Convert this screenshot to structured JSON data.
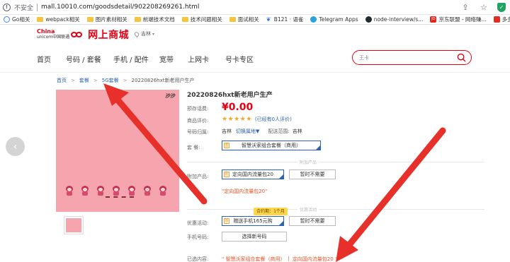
{
  "browser": {
    "insecure_label": "不安全",
    "url": "mall.10010.com/goodsdetail/902208269261.html",
    "bookmarks": [
      {
        "label": "Go相关",
        "icon": "google-icon"
      },
      {
        "label": "webpack相关",
        "icon": "folder-icon"
      },
      {
        "label": "图片素材相关",
        "icon": "folder-icon"
      },
      {
        "label": "前端技术文档",
        "icon": "folder-icon"
      },
      {
        "label": "技术问题相关",
        "icon": "folder-icon"
      },
      {
        "label": "面试相关",
        "icon": "folder-icon"
      },
      {
        "label": "B121 · 语雀",
        "icon": "yuque-icon"
      },
      {
        "label": "Telegram Apps",
        "icon": "telegram-icon"
      },
      {
        "label": "node-interview/s...",
        "icon": "github-icon"
      },
      {
        "label": "京东联盟 - 网络赚...",
        "icon": "jd-icon"
      },
      {
        "label": "多多进宝",
        "icon": "pdd-icon"
      }
    ]
  },
  "site": {
    "brand_en": "China",
    "brand_en2": "unicom",
    "brand_cn": "中国联通",
    "shop_name": "网上商城",
    "location": "吉林"
  },
  "nav": {
    "items": [
      "首页",
      "号码 / 套餐",
      "手机 / 配件",
      "宽带",
      "上网卡",
      "号卡专区"
    ],
    "search_placeholder": "王卡"
  },
  "breadcrumb": {
    "items": [
      "首页",
      "套餐",
      "5G套餐"
    ],
    "current": "20220826hxt新老用户生产"
  },
  "product": {
    "image_badge": "沙沙",
    "title": "20220826hxt新老用户生产",
    "price_label": "预存话费:",
    "price": "¥0.00",
    "rating_label": "商品评价:",
    "stars": 5,
    "rating_count": "(已经有0人评价)",
    "number_label": "号码归属:",
    "number_location": "吉林",
    "switch_link": "切换属地▼",
    "delivery_label": "配送范围:",
    "delivery_area": "吉林",
    "package_label": "套    餐:",
    "package_option": "智慧沃家组合套餐（商用）",
    "addon_section": "附加产品",
    "addon_label": "附加产品:",
    "addon_options": [
      "定向国内流量包20",
      "暂时不需要"
    ],
    "addon_note": "\"定向国内流量包20\"",
    "promo_section": "优惠活动",
    "promo_ribbon": "合约期：1个月",
    "promo_label": "优惠活动:",
    "promo_options": [
      "赠送手机165元购",
      "暂时不需要"
    ],
    "phone_label": "手机号码:",
    "phone_button": "选择新号码",
    "selected_label": "已选内容:",
    "selected_items": [
      "\" 智慧沃家组合套餐（商用）",
      "定向国内流量包20 \""
    ]
  },
  "colors": {
    "brand_red": "#e60012",
    "link_blue": "#2a62b5",
    "arrow_red": "#e8302a"
  }
}
